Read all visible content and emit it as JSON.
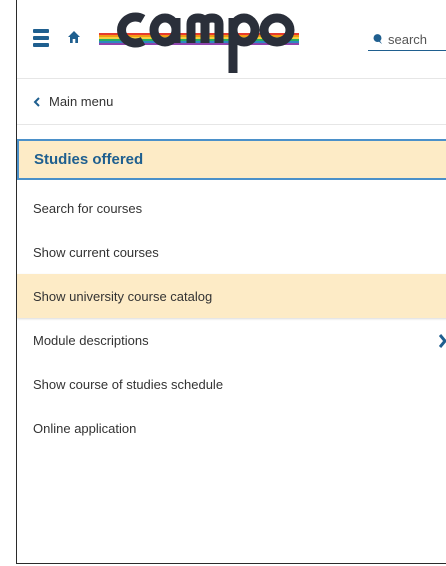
{
  "header": {
    "logo_text": "campo",
    "search_placeholder": "search"
  },
  "nav": {
    "back_label": "Main menu"
  },
  "section": {
    "title": "Studies offered"
  },
  "menu": {
    "items": [
      {
        "label": "Search for courses"
      },
      {
        "label": "Show current courses"
      },
      {
        "label": "Show university course catalog",
        "highlighted": true
      },
      {
        "label": "Module descriptions",
        "has_submenu": true
      },
      {
        "label": "Show course of studies schedule"
      },
      {
        "label": "Online application"
      }
    ]
  },
  "colors": {
    "accent": "#1f5f8f",
    "highlight": "#fdebc6",
    "focus_border": "#4b90c9"
  },
  "icons": [
    "menu-icon",
    "home-icon",
    "search-icon",
    "chevron-left-icon",
    "chevron-right-icon"
  ]
}
